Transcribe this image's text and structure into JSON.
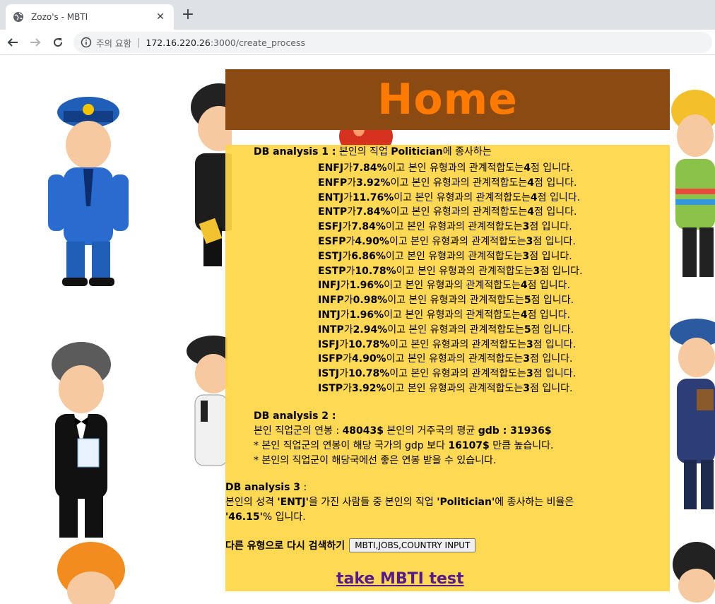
{
  "browser": {
    "tab_title": "Zozo's - MBTI",
    "close_glyph": "✕",
    "newtab_glyph": "+",
    "security_label": "주의 요함",
    "url_host": "172.16.220.26",
    "url_rest": ":3000/create_process"
  },
  "page": {
    "header_title": "Home",
    "db1": {
      "label": "DB analysis 1 :",
      "intro_pre": "본인의 직업",
      "job": "Politician",
      "intro_post": "에 종사하는",
      "rows": [
        {
          "type": "ENFJ",
          "pct": "7.84%",
          "score": "4"
        },
        {
          "type": "ENFP",
          "pct": "3.92%",
          "score": "4"
        },
        {
          "type": "ENTJ",
          "pct": "11.76%",
          "score": "4"
        },
        {
          "type": "ENTP",
          "pct": "7.84%",
          "score": "4"
        },
        {
          "type": "ESFJ",
          "pct": "7.84%",
          "score": "3"
        },
        {
          "type": "ESFP",
          "pct": "4.90%",
          "score": "3"
        },
        {
          "type": "ESTJ",
          "pct": "6.86%",
          "score": "3"
        },
        {
          "type": "ESTP",
          "pct": "10.78%",
          "score": "3"
        },
        {
          "type": "INFJ",
          "pct": "1.96%",
          "score": "4"
        },
        {
          "type": "INFP",
          "pct": "0.98%",
          "score": "5"
        },
        {
          "type": "INTJ",
          "pct": "1.96%",
          "score": "4"
        },
        {
          "type": "INTP",
          "pct": "2.94%",
          "score": "5"
        },
        {
          "type": "ISFJ",
          "pct": "10.78%",
          "score": "3"
        },
        {
          "type": "ISFP",
          "pct": "4.90%",
          "score": "3"
        },
        {
          "type": "ISTJ",
          "pct": "10.78%",
          "score": "3"
        },
        {
          "type": "ISTP",
          "pct": "3.92%",
          "score": "3"
        }
      ],
      "row_ga": "가",
      "row_mid": "이고 본인 유형과의 관계적합도는",
      "row_end": "점 입니다."
    },
    "db2": {
      "label": "DB analysis 2 :",
      "income_label": "본인 직업군의 연봉 :",
      "income_value": "48043$",
      "gdb_label": "본인의 거주국의 평균",
      "gdb_key": "gdb : 31936$",
      "note1_pre": "* 본인 직업군의 연봉이 해당 국가의 gdp 보다",
      "note1_value": "16107$",
      "note1_post": "만큼 높습니다.",
      "note2": "* 본인의 직업군이 해당국에선 좋은 연봉 받을 수 있습니다."
    },
    "db3": {
      "label": "DB analysis 3",
      "colon": " :",
      "line1_a": "본인의 성격",
      "type_quoted": "'ENTJ'",
      "line1_b": "을 가진 사람들 중 본인의 직업",
      "job_quoted": "'Politician'",
      "line1_c": "에 종사하는 비율은",
      "ratio": "'46.15'",
      "line2_post": "% 입니다."
    },
    "retry_label": "다른 유형으로 다시 검색하기",
    "retry_button": "MBTI,JOBS,COUNTRY INPUT",
    "take_test_link": "take MBTI test"
  }
}
